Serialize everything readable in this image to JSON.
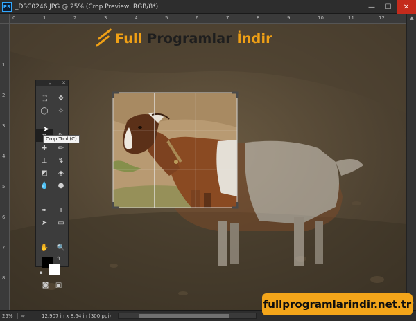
{
  "window": {
    "app_icon": "PS",
    "title": "_DSC0246.JPG @ 25% (Crop Preview, RGB/8*)",
    "minimize": "—",
    "maximize": "☐",
    "close": "✕"
  },
  "rulers": {
    "top_labels": [
      "0",
      "1",
      "2",
      "3",
      "4",
      "5",
      "6",
      "7",
      "8",
      "9",
      "10",
      "11",
      "12"
    ],
    "left_labels": [
      "1",
      "2",
      "3",
      "4",
      "5",
      "6",
      "7",
      "8"
    ]
  },
  "watermark": {
    "full": "Full",
    "programlar": " Programlar ",
    "indir": "İndir"
  },
  "toolbox": {
    "collapse": "»",
    "close": "✕",
    "tools": [
      {
        "name": "rect-marquee-tool-icon",
        "glyph": "⬚"
      },
      {
        "name": "move-tool-icon",
        "glyph": "✥"
      },
      {
        "name": "lasso-tool-icon",
        "glyph": "◯"
      },
      {
        "name": "magic-wand-tool-icon",
        "glyph": "✧"
      },
      {
        "name": "crop-tool-icon",
        "glyph": "⌗"
      },
      {
        "name": "eyedropper-tool-icon",
        "glyph": "✎"
      },
      {
        "name": "healing-brush-tool-icon",
        "glyph": "✚"
      },
      {
        "name": "brush-tool-icon",
        "glyph": "✏"
      },
      {
        "name": "clone-stamp-tool-icon",
        "glyph": "⊥"
      },
      {
        "name": "history-brush-tool-icon",
        "glyph": "↯"
      },
      {
        "name": "eraser-tool-icon",
        "glyph": "◩"
      },
      {
        "name": "paint-bucket-tool-icon",
        "glyph": "◈"
      },
      {
        "name": "blur-tool-icon",
        "glyph": "💧"
      },
      {
        "name": "dodge-tool-icon",
        "glyph": "●"
      },
      {
        "name": "pen-tool-icon",
        "glyph": "✒"
      },
      {
        "name": "type-tool-icon",
        "glyph": "T"
      },
      {
        "name": "path-selection-tool-icon",
        "glyph": "➤"
      },
      {
        "name": "rectangle-shape-tool-icon",
        "glyph": "▭"
      },
      {
        "name": "hand-tool-icon",
        "glyph": "✋"
      },
      {
        "name": "zoom-tool-icon",
        "glyph": "🔍"
      }
    ],
    "swap_glyph": "↰",
    "default_colors_glyph": "▪",
    "quick_mask_glyph": "◙",
    "screen_mode_glyph": "▣",
    "colors": {
      "foreground": "#000000",
      "background": "#ffffff"
    }
  },
  "tooltip": "Crop Tool (C)",
  "statusbar": {
    "zoom": "25%",
    "export_glyph": "⇨",
    "doc_info": "12.907 in x 8.64 in (300 ppi)",
    "arrow": "▶"
  },
  "site_badge": "fullprogramlarindir.net.tr",
  "colors": {
    "accent": "#f0a015",
    "badge": "#f3a51a"
  }
}
